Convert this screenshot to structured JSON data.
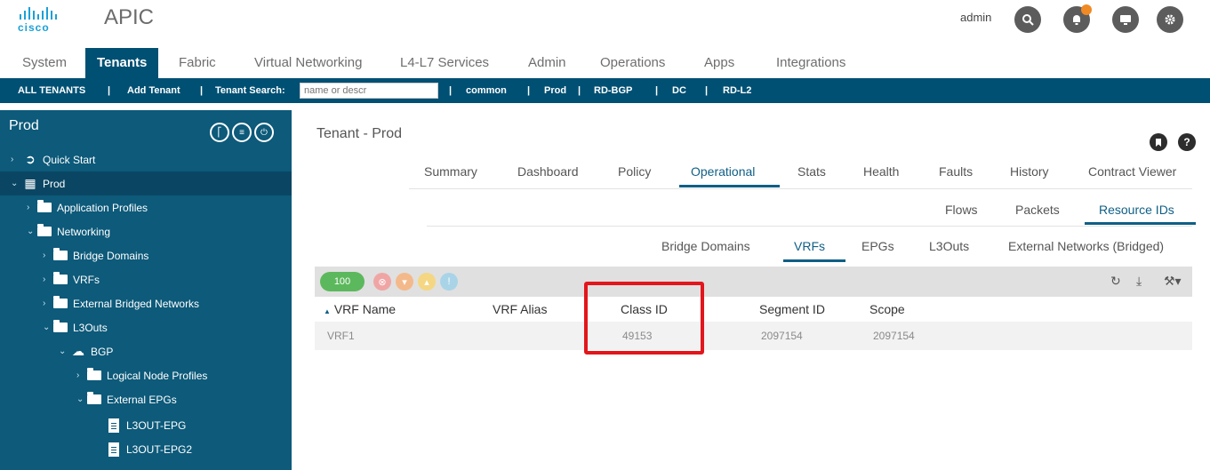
{
  "header": {
    "logo_text": "cisco",
    "app_title": "APIC",
    "user": "admin",
    "icons": [
      "search-icon",
      "bell-icon",
      "screen-icon",
      "gear-icon"
    ]
  },
  "main_tabs": [
    "System",
    "Tenants",
    "Fabric",
    "Virtual Networking",
    "L4-L7 Services",
    "Admin",
    "Operations",
    "Apps",
    "Integrations"
  ],
  "active_main_tab": "Tenants",
  "tenant_bar": {
    "all_tenants": "ALL TENANTS",
    "sep": "|",
    "add_tenant": "Add Tenant",
    "search_label": "Tenant Search:",
    "search_placeholder": "name or descr",
    "tenants": [
      "common",
      "Prod",
      "RD-BGP",
      "DC",
      "RD-L2"
    ]
  },
  "sidebar": {
    "title": "Prod",
    "items": [
      {
        "label": "Quick Start"
      },
      {
        "label": "Prod"
      },
      {
        "label": "Application Profiles"
      },
      {
        "label": "Networking"
      },
      {
        "label": "Bridge Domains"
      },
      {
        "label": "VRFs"
      },
      {
        "label": "External Bridged Networks"
      },
      {
        "label": "L3Outs"
      },
      {
        "label": "BGP"
      },
      {
        "label": "Logical Node Profiles"
      },
      {
        "label": "External EPGs"
      },
      {
        "label": "L3OUT-EPG"
      },
      {
        "label": "L3OUT-EPG2"
      }
    ]
  },
  "content": {
    "title": "Tenant - Prod",
    "tabs": [
      "Summary",
      "Dashboard",
      "Policy",
      "Operational",
      "Stats",
      "Health",
      "Faults",
      "History",
      "Contract Viewer"
    ],
    "active_tab": "Operational",
    "subtabs": [
      "Flows",
      "Packets",
      "Resource IDs"
    ],
    "active_subtab": "Resource IDs",
    "subsubtabs": [
      "Bridge Domains",
      "VRFs",
      "EPGs",
      "L3Outs",
      "External Networks (Bridged)"
    ],
    "active_subsubtab": "VRFs",
    "pill": "100",
    "filter_colors": [
      "#f0a5a5",
      "#f4b98a",
      "#f5d682",
      "#a9d4e8"
    ],
    "table": {
      "sort_glyph": "▲",
      "columns": [
        "VRF Name",
        "VRF Alias",
        "Class ID",
        "Segment ID",
        "Scope"
      ],
      "rows": [
        {
          "vrf_name": "VRF1",
          "vrf_alias": "",
          "class_id": "49153",
          "segment_id": "2097154",
          "scope": "2097154"
        }
      ]
    },
    "highlight_color": "#e2161c"
  }
}
